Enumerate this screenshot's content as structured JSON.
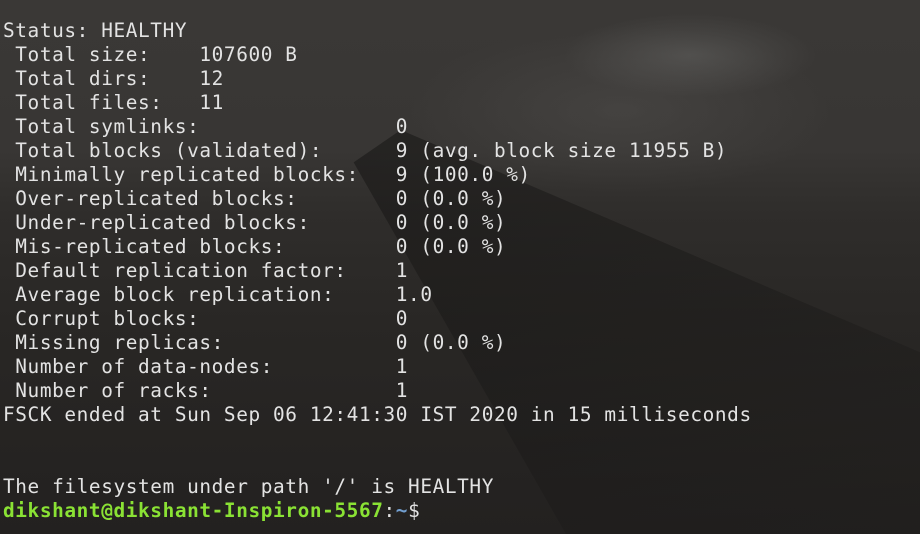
{
  "terminal": {
    "lines": [
      "Status: HEALTHY",
      " Total size:    107600 B",
      " Total dirs:    12",
      " Total files:   11",
      " Total symlinks:                0",
      " Total blocks (validated):      9 (avg. block size 11955 B)",
      " Minimally replicated blocks:   9 (100.0 %)",
      " Over-replicated blocks:        0 (0.0 %)",
      " Under-replicated blocks:       0 (0.0 %)",
      " Mis-replicated blocks:         0 (0.0 %)",
      " Default replication factor:    1",
      " Average block replication:     1.0",
      " Corrupt blocks:                0",
      " Missing replicas:              0 (0.0 %)",
      " Number of data-nodes:          1",
      " Number of racks:               1",
      "FSCK ended at Sun Sep 06 12:41:30 IST 2020 in 15 milliseconds",
      "",
      "",
      "The filesystem under path '/' is HEALTHY"
    ],
    "prompt": {
      "user_host": "dikshant@dikshant-Inspiron-5567",
      "colon": ":",
      "path": "~",
      "symbol": "$"
    }
  },
  "colors": {
    "text": "#e3e3e3",
    "prompt_user_host": "#8ae234",
    "prompt_path": "#729fcf",
    "background": "#302e2c"
  }
}
